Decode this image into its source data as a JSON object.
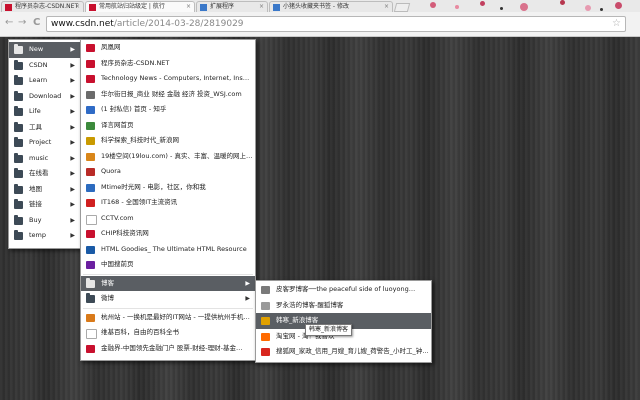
{
  "browser": {
    "tabs": [
      {
        "title": "程序员杂志-CSDN.NET",
        "active": false
      },
      {
        "title": "常用航站归站级定 | 航行",
        "active": true
      },
      {
        "title": "扩展程序",
        "active": false
      },
      {
        "title": "小猪头收藏夹书签 - 修改",
        "active": false
      }
    ],
    "url_host": "www.csdn.net",
    "url_path": "/article/2014-03-28/2819029",
    "back_glyph": "←",
    "forward_glyph": "→",
    "reload_glyph": "C",
    "star_glyph": "☆",
    "close_glyph": "×"
  },
  "bookmarks_menu": {
    "items": [
      {
        "label": "New",
        "has_submenu": true,
        "highlighted": true
      },
      {
        "label": "CSDN",
        "has_submenu": true
      },
      {
        "label": "Learn",
        "has_submenu": true
      },
      {
        "label": "Download",
        "has_submenu": true
      },
      {
        "label": "Life",
        "has_submenu": true
      },
      {
        "label": "工具",
        "has_submenu": true
      },
      {
        "label": "Project",
        "has_submenu": true
      },
      {
        "label": "music",
        "has_submenu": true
      },
      {
        "label": "在线看",
        "has_submenu": true
      },
      {
        "label": "地图",
        "has_submenu": true
      },
      {
        "label": "链接",
        "has_submenu": true
      },
      {
        "label": "Buy",
        "has_submenu": true
      },
      {
        "label": "temp",
        "has_submenu": true
      }
    ],
    "arrow_glyph": "▶"
  },
  "new_menu": {
    "items": [
      {
        "label": "凤凰网",
        "icon": "ifeng-icon",
        "color": "#c8102e"
      },
      {
        "label": "程序员杂志-CSDN.NET",
        "icon": "csdn-icon",
        "color": "#c8102e"
      },
      {
        "label": "Technology News - Computers, Internet, Ins…",
        "icon": "cnet-icon",
        "color": "#c8102e"
      },
      {
        "label": "华尔街日报_商业 财经 金融 经济 投资_WSJ.com",
        "icon": "wsj-icon",
        "color": "#6b6b6b"
      },
      {
        "label": "(1 封私信) 首页 - 知乎",
        "icon": "zhihu-icon",
        "color": "#2f6bc6"
      },
      {
        "label": "译言网首页",
        "icon": "yeeyan-icon",
        "color": "#3c8a3c"
      },
      {
        "label": "科学探索_科技时代_新浪网",
        "icon": "sina-icon",
        "color": "#c99a00"
      },
      {
        "label": "19楼空间(19lou.com) - 真实、丰富、温暖的网上…",
        "icon": "19lou-icon",
        "color": "#d9861a"
      },
      {
        "label": "Quora",
        "icon": "quora-icon",
        "color": "#b92b27"
      },
      {
        "label": "Mtime时光网 - 电影，社区，你和我",
        "icon": "mtime-icon",
        "color": "#2c6bbf"
      },
      {
        "label": "IT168 - 全国领IT主流资讯",
        "icon": "it168-icon",
        "color": "#d02020"
      },
      {
        "label": "CCTV.com",
        "icon": "cctv-icon",
        "color": "#ffffff"
      },
      {
        "label": "CHIP科技资讯网",
        "icon": "chip-icon",
        "color": "#c8102e"
      },
      {
        "label": "HTML Goodies_ The Ultimate HTML Resource",
        "icon": "html-goodies-icon",
        "color": "#1a5aa6"
      },
      {
        "label": "中国搜前页",
        "icon": "yahoo-icon",
        "color": "#6b1fa0"
      },
      {
        "label": "博客",
        "folder": true,
        "has_submenu": true,
        "highlighted": true
      },
      {
        "label": "微博",
        "folder": true,
        "has_submenu": true
      },
      {
        "label": "杭州站 - 一换机是最好的IT网站 - 一提供杭州手机…",
        "icon": "hz-icon",
        "color": "#d97a1a"
      },
      {
        "label": "维基百科，自由的百科全书",
        "icon": "wikipedia-icon",
        "color": "#ffffff"
      },
      {
        "label": "金融界-中国领先金融门户 股票-财经-理财-基金…",
        "icon": "jrj-icon",
        "color": "#c8102e"
      }
    ]
  },
  "blog_menu": {
    "items": [
      {
        "label": "皮客罗博客──the peaceful side of luoyong…",
        "icon": "blog-icon",
        "color": "#7a7a7a"
      },
      {
        "label": "罗永浩的博客-醒狐博客",
        "icon": "doc-icon",
        "color": "#9a9a9a"
      },
      {
        "label": "韩寒_新浪博客",
        "icon": "sina-blog-icon",
        "color": "#e0a000",
        "highlighted": true
      },
      {
        "label": "淘宝网 - 淘！我喜欢",
        "icon": "taobao-icon",
        "color": "#ff6a00"
      },
      {
        "label": "搜狐网_家政_信用_月嫂_育儿嫂_荷警告_小时工_钟…",
        "icon": "sohu-icon",
        "color": "#d8261e"
      }
    ]
  },
  "tooltip": "韩寒_新浪博客"
}
